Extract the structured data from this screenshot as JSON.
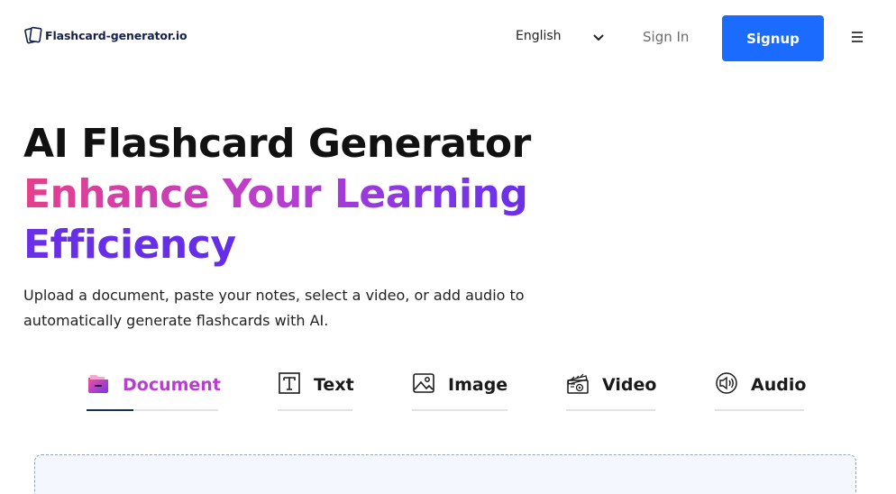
{
  "header": {
    "brand": "Flashcard-generator.io",
    "language": "English",
    "signin_label": "Sign In",
    "signup_label": "Signup"
  },
  "hero": {
    "title_line1": "AI Flashcard Generator",
    "title_line2": "Enhance Your Learning",
    "title_line3": "Efficiency",
    "subtitle": "Upload a document, paste your notes, select a video, or add audio to automatically generate flashcards with AI."
  },
  "tabs": [
    {
      "label": "Document",
      "icon": "folder-icon",
      "active": true
    },
    {
      "label": "Text",
      "icon": "text-icon",
      "active": false
    },
    {
      "label": "Image",
      "icon": "image-icon",
      "active": false
    },
    {
      "label": "Video",
      "icon": "video-icon",
      "active": false
    },
    {
      "label": "Audio",
      "icon": "audio-icon",
      "active": false
    }
  ],
  "colors": {
    "primary": "#1b6bff",
    "gradient_start": "#e63f8c",
    "gradient_mid": "#b83ed1",
    "gradient_end": "#5a2ae6",
    "brand_text": "#16214a"
  }
}
